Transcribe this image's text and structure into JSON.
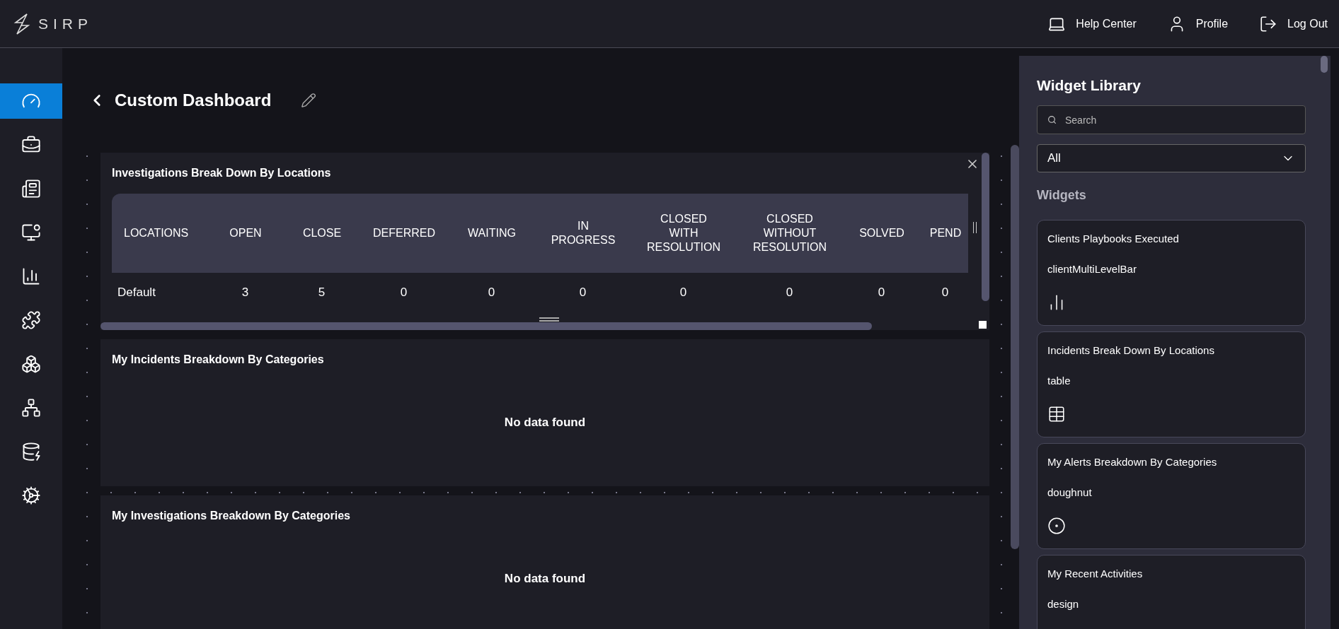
{
  "topbar": {
    "logo": "SIRP",
    "links": [
      {
        "kind": "help",
        "label": "Help Center"
      },
      {
        "kind": "profile",
        "label": "Profile"
      },
      {
        "kind": "logout",
        "label": "Log Out"
      }
    ]
  },
  "sidebar": {
    "items": [
      {
        "kind": "dashboard",
        "selected": true
      },
      {
        "kind": "cases",
        "selected": false
      },
      {
        "kind": "list",
        "selected": false
      },
      {
        "kind": "alerts",
        "selected": false
      },
      {
        "kind": "reports",
        "selected": false
      },
      {
        "kind": "integrations",
        "selected": false
      },
      {
        "kind": "assets",
        "selected": false
      },
      {
        "kind": "workflow",
        "selected": false
      },
      {
        "kind": "data",
        "selected": false
      },
      {
        "kind": "settings",
        "selected": false
      }
    ]
  },
  "page": {
    "title": "Custom Dashboard"
  },
  "widgets": [
    {
      "kind": "table",
      "title": "Investigations Break Down By Locations",
      "columns": [
        "LOCATIONS",
        "OPEN",
        "CLOSE",
        "DEFERRED",
        "WAITING",
        "IN PROGRESS",
        "CLOSED WITH RESOLUTION",
        "CLOSED WITHOUT RESOLUTION",
        "SOLVED",
        "PEND"
      ],
      "rows": [
        [
          "Default",
          "3",
          "5",
          "0",
          "0",
          "0",
          "0",
          "0",
          "0",
          "0"
        ]
      ]
    },
    {
      "kind": "empty",
      "title": "My Incidents Breakdown By Categories",
      "message": "No data found"
    },
    {
      "kind": "empty",
      "title": "My Investigations Breakdown By Categories",
      "message": "No data found"
    }
  ],
  "library": {
    "title": "Widget Library",
    "search": {
      "placeholder": "Search"
    },
    "filter": {
      "value": "All"
    },
    "section": "Widgets",
    "cards": [
      {
        "kind": "bar",
        "title": "Clients Playbooks Executed",
        "type": "clientMultiLevelBar"
      },
      {
        "kind": "table",
        "title": "Incidents Break Down By Locations",
        "type": "table"
      },
      {
        "kind": "doughnut",
        "title": "My Alerts Breakdown By Categories",
        "type": "doughnut"
      },
      {
        "kind": "design",
        "title": "My Recent Activities",
        "type": "design"
      }
    ]
  }
}
